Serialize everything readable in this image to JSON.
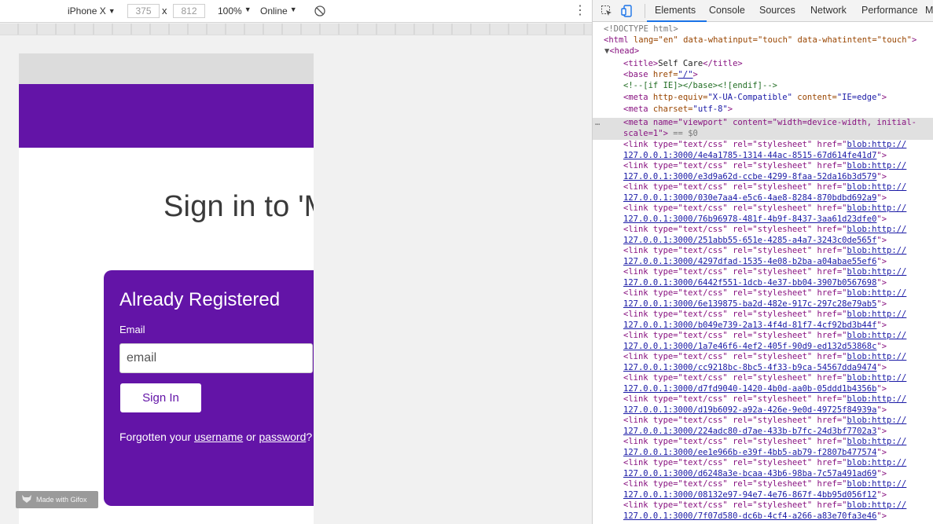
{
  "toolbar": {
    "device": "iPhone X",
    "width": "375",
    "times": "x",
    "height": "812",
    "zoom": "100%",
    "network": "Online"
  },
  "device_page": {
    "heading": "Sign in to 'My",
    "card": {
      "title": "Already Registered",
      "email_label": "Email",
      "email_placeholder": "email",
      "signin_label": "Sign In",
      "forgot_prefix": "Forgotten your ",
      "forgot_username": "username",
      "forgot_or": " or ",
      "forgot_password": "password",
      "forgot_suffix": "?"
    },
    "colors": {
      "brand": "#6314a7"
    }
  },
  "watermark": "Made with Gifox",
  "devtools": {
    "tabs": [
      "Elements",
      "Console",
      "Sources",
      "Network",
      "Performance",
      "M"
    ],
    "active_tab": "Elements",
    "dom": {
      "doctype": "<!DOCTYPE html>",
      "html_open": {
        "tag": "<html",
        "attrs": " lang=\"en\" data-whatinput=\"touch\" data-whatintent=\"touch\"",
        "close": ">"
      },
      "head_open": "<head>",
      "title": {
        "open": "<title>",
        "text": "Self Care",
        "close": "</title>"
      },
      "base": {
        "tag": "<base",
        "an": " href=",
        "av": "\"/\"",
        "close": ">"
      },
      "comment": "<!--[if IE]></base><![endif]-->",
      "meta1": {
        "tag": "<meta",
        "an1": " http-equiv=",
        "av1": "\"X-UA-Compatible\"",
        "an2": " content=",
        "av2": "\"IE=edge\"",
        "close": ">"
      },
      "meta2": {
        "tag": "<meta",
        "an1": " charset=",
        "av1": "\"utf-8\"",
        "close": ">"
      },
      "meta3": {
        "line1": "<meta name=\"viewport\" content=\"width=device-width, initial-",
        "line2": "scale=1\">",
        "eq": " == $0"
      },
      "link_prefix": "<link type=\"text/css\" rel=\"stylesheet\" href=\"",
      "link_head": "blob:http://",
      "links": [
        "127.0.0.1:3000/4e4a1785-1314-44ac-8515-67d614fe41d7",
        "127.0.0.1:3000/e3d9a62d-ccbe-4299-8faa-52da16b3d579",
        "127.0.0.1:3000/030e7aa4-e5c6-4ae8-8284-870bdbd692a9",
        "127.0.0.1:3000/76b96978-481f-4b9f-8437-3aa61d23dfe0",
        "127.0.0.1:3000/251abb55-651e-4285-a4a7-3243c0de565f",
        "127.0.0.1:3000/4297dfad-1535-4e08-b2ba-a04abae55ef6",
        "127.0.0.1:3000/6442f551-1dcb-4e37-bb04-3907b0567698",
        "127.0.0.1:3000/6e139875-ba2d-482e-917c-297c28e79ab5",
        "127.0.0.1:3000/b049e739-2a13-4f4d-81f7-4cf92bd3b44f",
        "127.0.0.1:3000/1a7e46f6-4ef2-405f-90d9-ed132d53868c",
        "127.0.0.1:3000/cc9218bc-8bc5-4f33-b9ca-54567dda9474",
        "127.0.0.1:3000/d7fd9040-1420-4b0d-aa0b-05ddd1b4356b",
        "127.0.0.1:3000/d19b6092-a92a-426e-9e0d-49725f84939a",
        "127.0.0.1:3000/224adc80-d7ae-433b-b7fc-24d3bf7702a3",
        "127.0.0.1:3000/ee1e966b-e39f-4bb5-ab79-f2807b477574",
        "127.0.0.1:3000/d6248a3e-bcaa-43b6-98ba-7c57a491ad69",
        "127.0.0.1:3000/08132e97-94e7-4e76-867f-4bb95d056f12",
        "127.0.0.1:3000/7f07d580-dc6b-4cf4-a266-a83e70fa3e46"
      ]
    }
  }
}
